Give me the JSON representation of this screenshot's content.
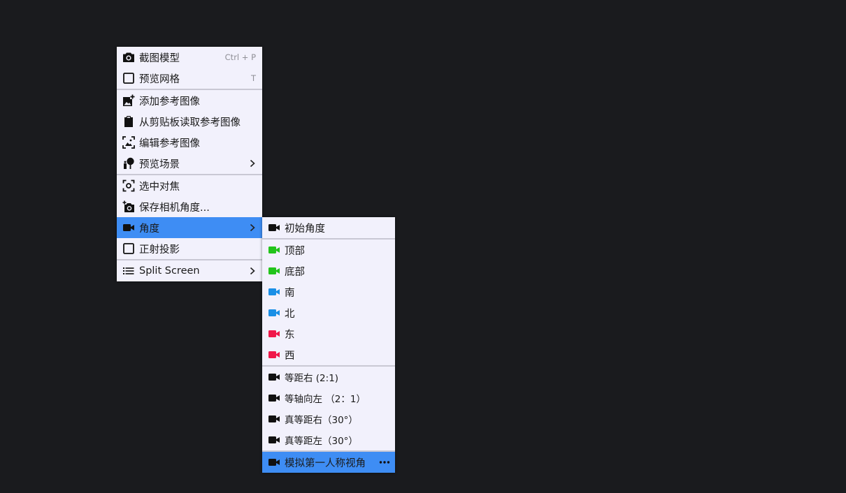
{
  "colors": {
    "background": "#1a1b1e",
    "menu_bg": "#f2f1fc",
    "highlight": "#3e8df4",
    "separator": "#c9c8d4",
    "icon_dark": "#111111",
    "icon_green": "#22c41a",
    "icon_blue": "#1a8fe6",
    "icon_red": "#f0184a"
  },
  "main_menu": {
    "screenshot_label": "截图模型",
    "screenshot_shortcut": "Ctrl + P",
    "preview_grid_label": "预览网格",
    "preview_grid_shortcut": "T",
    "add_reference_label": "添加参考图像",
    "paste_reference_label": "从剪贴板读取参考图像",
    "edit_reference_label": "编辑参考图像",
    "preview_scene_label": "预览场景",
    "focus_selection_label": "选中对焦",
    "save_camera_label": "保存相机角度...",
    "angle_label": "角度",
    "orthographic_label": "正射投影",
    "split_screen_label": "Split Screen"
  },
  "angle_submenu": {
    "initial_label": "初始角度",
    "top_label": "顶部",
    "bottom_label": "底部",
    "south_label": "南",
    "north_label": "北",
    "east_label": "东",
    "west_label": "西",
    "iso_right_label": "等距右 (2:1)",
    "iso_left_label": "等轴向左 （2：1）",
    "true_iso_right_label": "真等距右（30°）",
    "true_iso_left_label": "真等距左（30°）",
    "first_person_label": "模拟第一人称视角"
  }
}
